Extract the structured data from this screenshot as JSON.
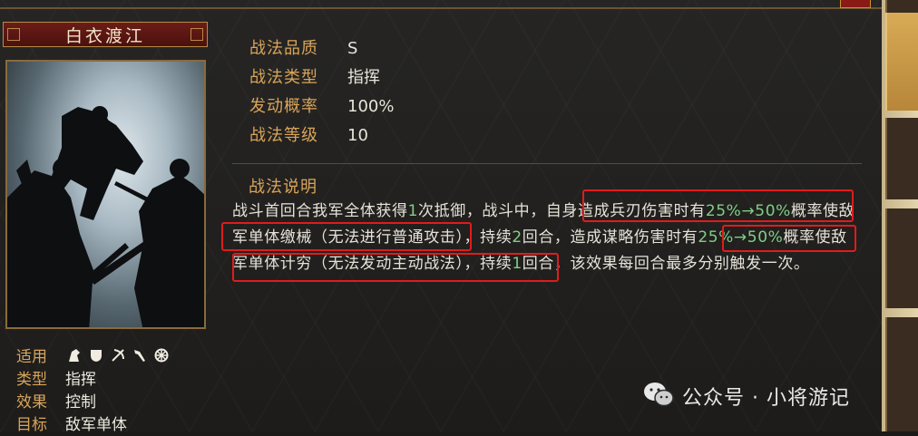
{
  "skill": {
    "name": "白衣渡江",
    "attributes": [
      {
        "label": "战法品质",
        "value": "S"
      },
      {
        "label": "战法类型",
        "value": "指挥"
      },
      {
        "label": "发动概率",
        "value": "100%"
      },
      {
        "label": "战法等级",
        "value": "10"
      }
    ],
    "description_title": "战法说明",
    "description": {
      "p1": "战斗首回合我军全体获得",
      "n1": "1",
      "p2": "次抵御，战斗中，自身造成兵刃伤害时有",
      "n2": "25%→50%",
      "p3": "概率使敌军单体缴械（无法进行普通攻击），持续",
      "n3": "2",
      "p4": "回合，造成谋略伤害时有",
      "n4": "25%→50%",
      "p5": "概率使敌军单体计穷（无法发动主动战法），持续",
      "n5": "1",
      "p6": "回合，该效果每回合最多分别触发一次。"
    }
  },
  "info": {
    "applicable_label": "适用",
    "applicable_icons": [
      "cavalry-icon",
      "shield-icon",
      "bow-icon",
      "spear-icon",
      "wheel-icon"
    ],
    "type_label": "类型",
    "type_value": "指挥",
    "effect_label": "效果",
    "effect_value": "控制",
    "target_label": "目标",
    "target_value": "敌军单体"
  },
  "watermark": "公众号 · 小将游记",
  "colors": {
    "accent": "#d9a55a",
    "highlight": "#7fcf86",
    "annotation": "#e01c1c"
  }
}
